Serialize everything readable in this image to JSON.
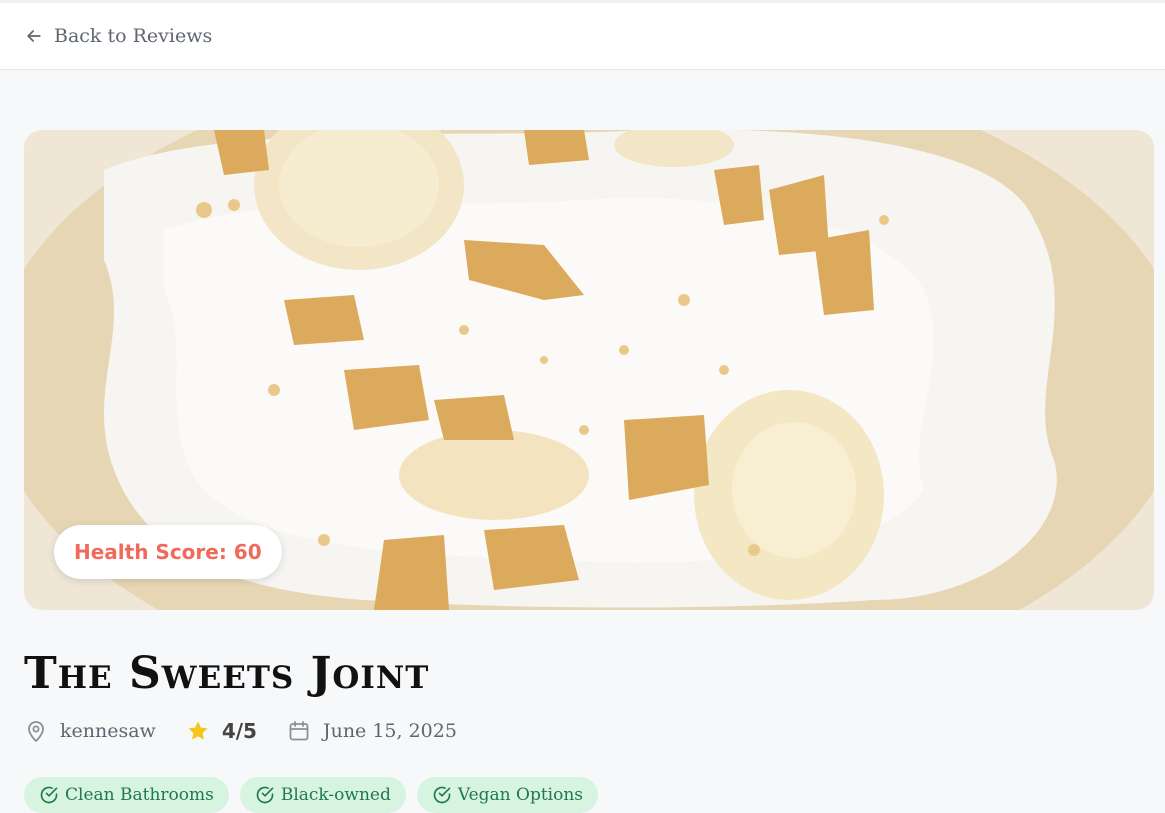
{
  "header": {
    "back_label": "Back to Reviews"
  },
  "hero": {
    "health_score_label": "Health Score: 60",
    "image": "banana-pudding-photo"
  },
  "place": {
    "name": "The Sweets Joint",
    "location": "kennesaw",
    "rating": "4/5",
    "date": "June 15, 2025"
  },
  "tags": [
    {
      "label": "Clean Bathrooms"
    },
    {
      "label": "Black-owned"
    },
    {
      "label": "Vegan Options"
    }
  ],
  "colors": {
    "score_text": "#ef6a5a",
    "tag_bg": "#d7f4e0",
    "tag_text": "#20794a",
    "star": "#f5c518"
  },
  "icons": {
    "back": "arrow-left-icon",
    "location": "map-pin-icon",
    "rating": "star-icon",
    "date": "calendar-icon",
    "tag": "check-circle-icon"
  }
}
